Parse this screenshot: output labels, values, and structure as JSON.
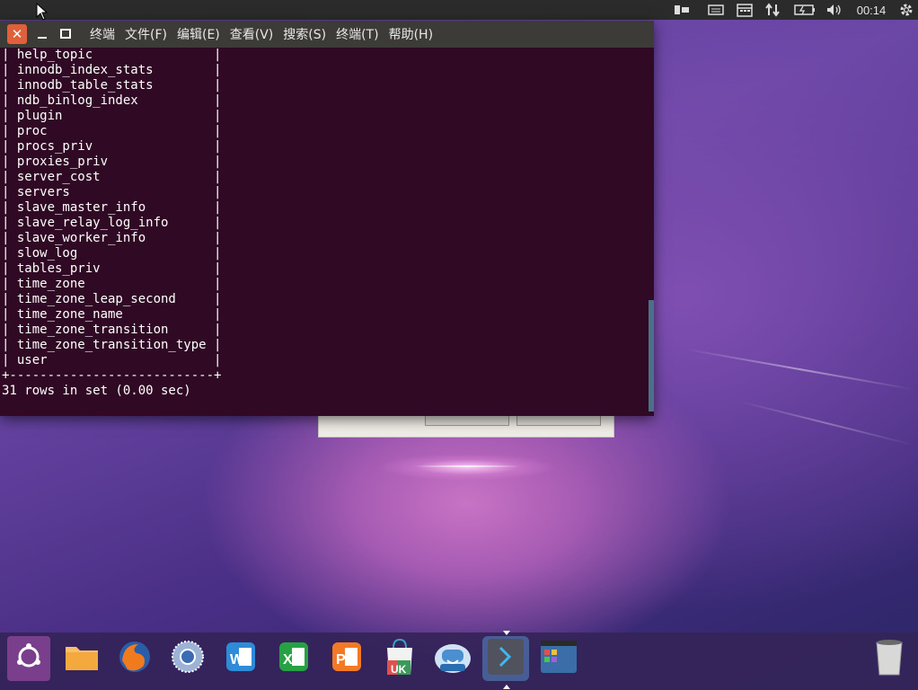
{
  "topbar": {
    "clock": "00:14",
    "indicators": [
      "keyboard-icon",
      "calendar-icon",
      "network-icon",
      "battery-icon",
      "volume-icon",
      "gear-icon"
    ]
  },
  "terminal": {
    "menu": [
      "终端",
      "文件(F)",
      "编辑(E)",
      "查看(V)",
      "搜索(S)",
      "终端(T)",
      "帮助(H)"
    ],
    "lines": [
      "| help_topic                |",
      "| innodb_index_stats        |",
      "| innodb_table_stats        |",
      "| ndb_binlog_index          |",
      "| plugin                    |",
      "| proc                      |",
      "| procs_priv                |",
      "| proxies_priv              |",
      "| server_cost               |",
      "| servers                   |",
      "| slave_master_info         |",
      "| slave_relay_log_info      |",
      "| slave_worker_info         |",
      "| slow_log                  |",
      "| tables_priv               |",
      "| time_zone                 |",
      "| time_zone_leap_second     |",
      "| time_zone_name            |",
      "| time_zone_transition      |",
      "| time_zone_transition_type |",
      "| user                      |",
      "+---------------------------+",
      "31 rows in set (0.00 sec)"
    ]
  },
  "dock": {
    "items": [
      {
        "name": "ubuntu-kylin-start",
        "icon": "ubuntu-logo-icon",
        "color": "#7a3f8c"
      },
      {
        "name": "files",
        "icon": "folder-icon",
        "color": "#f6a73c"
      },
      {
        "name": "firefox",
        "icon": "firefox-icon",
        "color": "#e25f20"
      },
      {
        "name": "chromium",
        "icon": "browser-icon",
        "color": "#5a78a8"
      },
      {
        "name": "wps-writer",
        "icon": "writer-icon",
        "color": "#2f8bd8"
      },
      {
        "name": "wps-spreadsheets",
        "icon": "spreadsheet-icon",
        "color": "#27a143"
      },
      {
        "name": "wps-presentation",
        "icon": "presentation-icon",
        "color": "#f27a26"
      },
      {
        "name": "software-center",
        "icon": "store-bag-icon",
        "color": "#eaeaea"
      },
      {
        "name": "kylin-assistant",
        "icon": "assistant-icon",
        "color": "#4c8fd0"
      },
      {
        "name": "terminal",
        "icon": "terminal-icon",
        "color": "#4a4e5a"
      },
      {
        "name": "workspace-switcher",
        "icon": "workspaces-icon",
        "color": "#3b6ea8"
      },
      {
        "name": "trash",
        "icon": "trash-icon",
        "color": "#cfcfcf"
      }
    ],
    "active": "terminal"
  }
}
